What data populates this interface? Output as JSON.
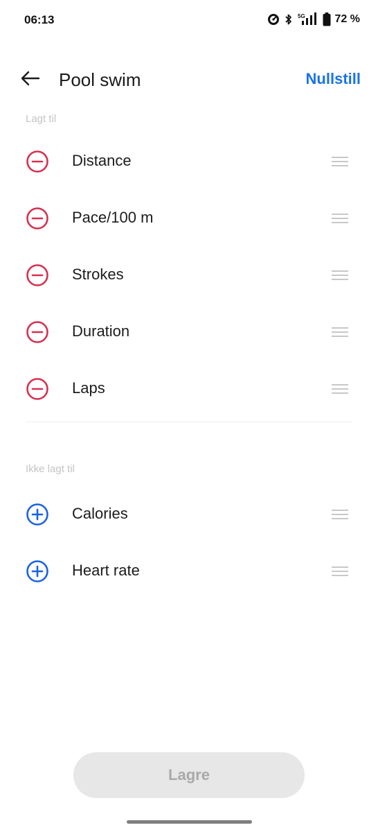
{
  "status_bar": {
    "time": "06:13",
    "network": "5G",
    "battery": "72 %",
    "icons": [
      "speedometer-icon",
      "bluetooth-icon",
      "signal-icon",
      "battery-icon"
    ]
  },
  "header": {
    "back_icon": "arrow-left-icon",
    "title": "Pool swim",
    "reset_label": "Nullstill"
  },
  "added": {
    "label": "Lagt til",
    "items": [
      {
        "label": "Distance",
        "icon": "remove-circle-icon"
      },
      {
        "label": "Pace/100 m",
        "icon": "remove-circle-icon"
      },
      {
        "label": "Strokes",
        "icon": "remove-circle-icon"
      },
      {
        "label": "Duration",
        "icon": "remove-circle-icon"
      },
      {
        "label": "Laps",
        "icon": "remove-circle-icon"
      }
    ]
  },
  "not_added": {
    "label": "Ikke lagt til",
    "items": [
      {
        "label": "Calories",
        "icon": "add-circle-icon"
      },
      {
        "label": "Heart rate",
        "icon": "add-circle-icon"
      }
    ]
  },
  "save_label": "Lagre",
  "colors": {
    "accent": "#1a73e8",
    "remove": "#d6304f",
    "add": "#1a62e0",
    "section_label": "#c4c4c4",
    "disabled_button": "#e7e7e7",
    "disabled_text": "#a9a9a9"
  }
}
